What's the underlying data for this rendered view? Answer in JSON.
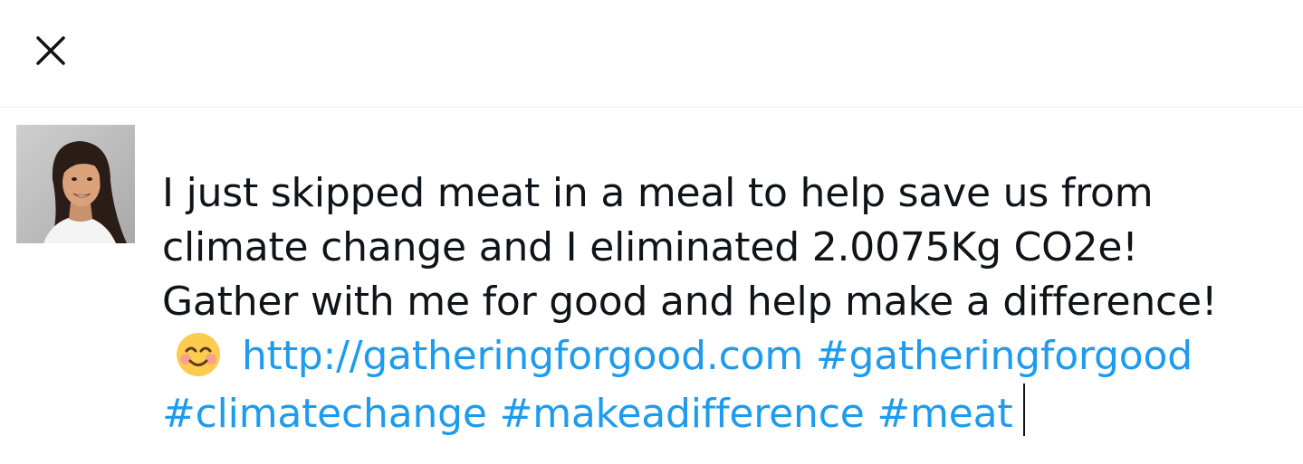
{
  "dialog": {
    "close_icon": "close-icon"
  },
  "author": {
    "avatar_icon": "avatar-photo"
  },
  "tweet": {
    "line1": "I just skipped meat in a meal to help save us from",
    "line2": "climate change and I eliminated 2.0075Kg CO2e!",
    "line3": "Gather with me for good and help make a difference!",
    "emoji_icon": "smiling-face-emoji",
    "url": "http://gatheringforgood.com",
    "hashtag1": "#gatheringforgood",
    "hashtag2": "#climatechange",
    "hashtag3": "#makeadifference",
    "hashtag4": "#meat"
  },
  "colors": {
    "link": "#1d9bf0",
    "text": "#0f1419",
    "divider": "#ebeef0"
  }
}
